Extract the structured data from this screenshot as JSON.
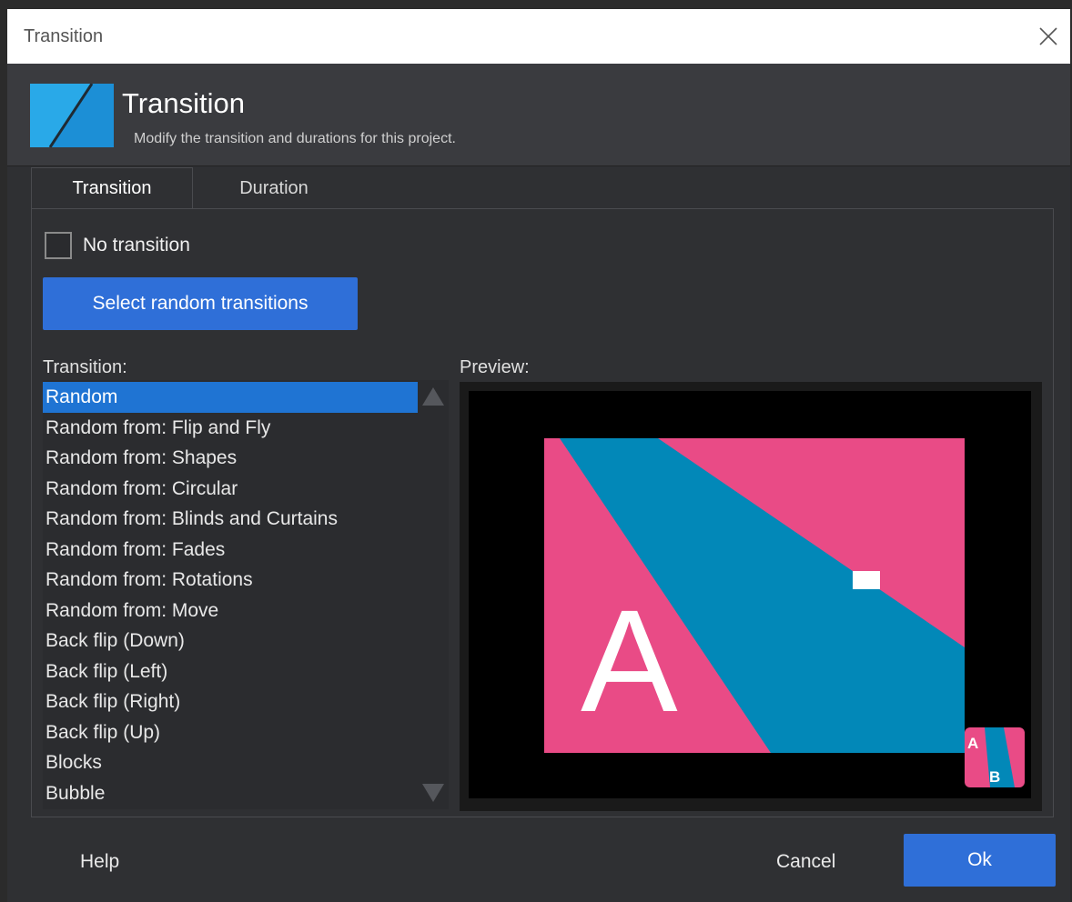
{
  "window": {
    "title": "Transition"
  },
  "header": {
    "title": "Transition",
    "subtitle": "Modify the transition and durations for this project.",
    "icon": "transition-logo-icon"
  },
  "tabs": [
    {
      "label": "Transition",
      "active": true
    },
    {
      "label": "Duration",
      "active": false
    }
  ],
  "options": {
    "no_transition_label": "No transition",
    "no_transition_checked": false,
    "random_button_label": "Select random transitions"
  },
  "list": {
    "label": "Transition:",
    "selected_index": 0,
    "items": [
      "Random",
      "Random from: Flip and Fly",
      "Random from: Shapes",
      "Random from: Circular",
      "Random from: Blinds and Curtains",
      "Random from: Fades",
      "Random from: Rotations",
      "Random from: Move",
      "Back flip (Down)",
      "Back flip (Left)",
      "Back flip (Right)",
      "Back flip (Up)",
      "Blocks",
      "Bubble"
    ]
  },
  "preview": {
    "label": "Preview:",
    "slide_a_letter": "A",
    "thumb_a_letter": "A",
    "thumb_b_letter": "B",
    "colors": {
      "pink": "#e94b86",
      "blue": "#0288b8",
      "black": "#000000"
    }
  },
  "footer": {
    "help_label": "Help",
    "cancel_label": "Cancel",
    "ok_label": "Ok"
  },
  "colors": {
    "accent": "#2f6fd8",
    "selection": "#1f74d3",
    "background": "#2f3033"
  }
}
